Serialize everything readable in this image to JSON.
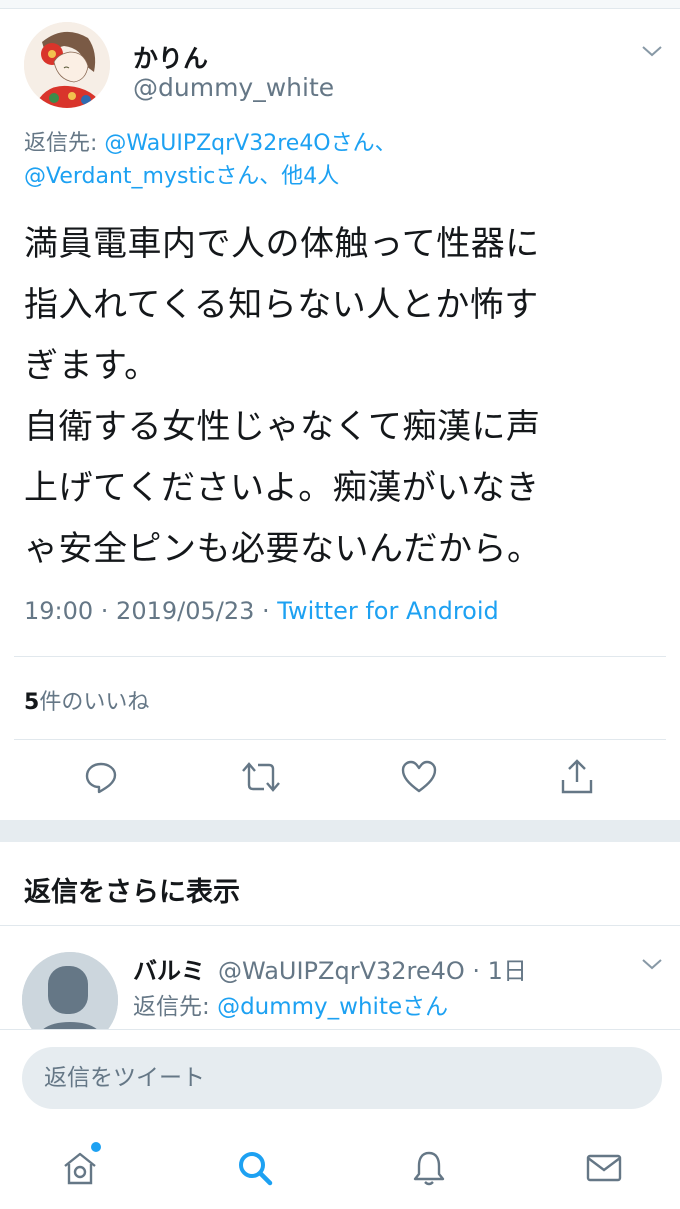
{
  "tweet": {
    "name": "かりん",
    "handle": "@dummy_white",
    "reply_prefix": "返信先: ",
    "reply_user1": "@WaUIPZqrV32re4O",
    "reply_sep1": "さん、",
    "reply_user2": "@Verdant_mystic",
    "reply_sep2": "さん、他4人",
    "body": "満員電車内で人の体触って性器に\n指入れてくる知らない人とか怖す\nぎます。\n自衛する女性じゃなくて痴漢に声\n上げてくださいよ。痴漢がいなき\nゃ安全ピンも必要ないんだから。",
    "time": "19:00 · 2019/05/23 · ",
    "source": "Twitter for Android",
    "likes_count": "5",
    "likes_label": "件のいいね",
    "actions": [
      "reply-icon",
      "retweet-icon",
      "like-icon",
      "share-icon"
    ]
  },
  "more_replies": {
    "title": "返信をさらに表示",
    "reply": {
      "name": "バルミ",
      "handle": "@WaUIPZqrV32re4O · 1日",
      "reply_prefix": "返信先: ",
      "reply_user": "@dummy_white",
      "reply_suffix": "さん"
    }
  },
  "composer": {
    "placeholder": "返信をツイート"
  },
  "tabbar": {
    "items": [
      "home-icon",
      "search-icon",
      "notifications-icon",
      "messages-icon"
    ],
    "active": "search-icon"
  },
  "colors": {
    "accent": "#1da1f2",
    "secondary_text": "#657786",
    "divider": "#e1e8ed"
  }
}
